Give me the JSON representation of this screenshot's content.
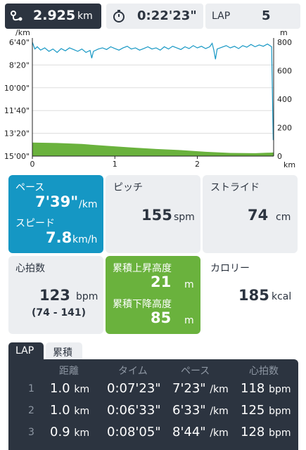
{
  "topbar": {
    "distance": {
      "icon": "route-icon",
      "value": "2.925",
      "unit": "km"
    },
    "time": {
      "icon": "stopwatch-icon",
      "value": "0:22'23\""
    },
    "lap": {
      "label": "LAP",
      "value": "5"
    }
  },
  "chart_data": {
    "type": "line",
    "x_label": "km",
    "x_ticks": [
      "0",
      "1",
      "2"
    ],
    "x_range": [
      0,
      2.925
    ],
    "left_axis": {
      "unit": "/km",
      "ticks": [
        "6'40\"",
        "8'20\"",
        "10'00\"",
        "11'40\"",
        "13'20\"",
        "15'00\""
      ],
      "range_sec": [
        400,
        900
      ],
      "inverted": true
    },
    "right_axis": {
      "unit": "m",
      "ticks": [
        "800",
        "600",
        "400",
        "200",
        "0"
      ],
      "range": [
        0,
        800
      ]
    },
    "series": [
      {
        "kind": "pace",
        "color": "#1597c4",
        "points": [
          [
            0,
            400
          ],
          [
            0.03,
            430
          ],
          [
            0.06,
            420
          ],
          [
            0.1,
            435
          ],
          [
            0.15,
            425
          ],
          [
            0.2,
            440
          ],
          [
            0.25,
            430
          ],
          [
            0.3,
            445
          ],
          [
            0.35,
            428
          ],
          [
            0.4,
            438
          ],
          [
            0.45,
            425
          ],
          [
            0.5,
            432
          ],
          [
            0.55,
            440
          ],
          [
            0.6,
            430
          ],
          [
            0.65,
            445
          ],
          [
            0.7,
            436
          ],
          [
            0.72,
            470
          ],
          [
            0.74,
            440
          ],
          [
            0.8,
            430
          ],
          [
            0.85,
            425
          ],
          [
            0.9,
            432
          ],
          [
            0.95,
            420
          ],
          [
            1.0,
            428
          ],
          [
            1.05,
            435
          ],
          [
            1.1,
            425
          ],
          [
            1.15,
            418
          ],
          [
            1.2,
            430
          ],
          [
            1.25,
            425
          ],
          [
            1.3,
            435
          ],
          [
            1.35,
            428
          ],
          [
            1.4,
            420
          ],
          [
            1.45,
            430
          ],
          [
            1.5,
            425
          ],
          [
            1.55,
            435
          ],
          [
            1.6,
            420
          ],
          [
            1.65,
            430
          ],
          [
            1.7,
            418
          ],
          [
            1.75,
            425
          ],
          [
            1.8,
            432
          ],
          [
            1.85,
            420
          ],
          [
            1.9,
            428
          ],
          [
            1.95,
            415
          ],
          [
            2.0,
            425
          ],
          [
            2.05,
            418
          ],
          [
            2.1,
            428
          ],
          [
            2.15,
            420
          ],
          [
            2.18,
            405
          ],
          [
            2.2,
            435
          ],
          [
            2.22,
            475
          ],
          [
            2.24,
            430
          ],
          [
            2.3,
            422
          ],
          [
            2.35,
            415
          ],
          [
            2.4,
            425
          ],
          [
            2.45,
            418
          ],
          [
            2.5,
            428
          ],
          [
            2.55,
            415
          ],
          [
            2.6,
            422
          ],
          [
            2.65,
            410
          ],
          [
            2.7,
            420
          ],
          [
            2.75,
            412
          ],
          [
            2.8,
            418
          ],
          [
            2.85,
            408
          ],
          [
            2.88,
            415
          ],
          [
            2.9,
            420
          ],
          [
            2.92,
            830
          ]
        ]
      },
      {
        "kind": "elevation",
        "color": "#6ab23d",
        "points": [
          [
            0,
            95
          ],
          [
            0.3,
            92
          ],
          [
            0.6,
            85
          ],
          [
            0.9,
            72
          ],
          [
            1.2,
            60
          ],
          [
            1.5,
            50
          ],
          [
            1.8,
            42
          ],
          [
            2.1,
            30
          ],
          [
            2.4,
            22
          ],
          [
            2.7,
            20
          ],
          [
            2.925,
            25
          ]
        ]
      }
    ]
  },
  "cards": {
    "pace": {
      "label": "ペース",
      "value": "7'39\"",
      "unit": "/km"
    },
    "speed": {
      "label": "スピード",
      "value": "7.8",
      "unit": "km/h"
    },
    "pitch": {
      "label": "ピッチ",
      "value": "155",
      "unit": "spm"
    },
    "stride": {
      "label": "ストライド",
      "value": "74",
      "unit": "cm"
    },
    "heart": {
      "label": "心拍数",
      "value": "123",
      "unit": "bpm",
      "range": "(74 - 141)"
    },
    "ascent": {
      "label": "累積上昇高度",
      "value": "21",
      "unit": "m"
    },
    "descent": {
      "label": "累積下降高度",
      "value": "85",
      "unit": "m"
    },
    "calorie": {
      "label": "カロリー",
      "value": "185",
      "unit": "kcal"
    }
  },
  "laps": {
    "tabs": [
      "LAP",
      "累積"
    ],
    "headers": [
      "距離",
      "タイム",
      "ペース",
      "心拍数"
    ],
    "rows": [
      {
        "n": "1",
        "dist": "1.0",
        "dist_unit": "km",
        "time": "0:07'23\"",
        "pace": "7'23\"",
        "pace_unit": "/km",
        "hr": "118",
        "hr_unit": "bpm"
      },
      {
        "n": "2",
        "dist": "1.0",
        "dist_unit": "km",
        "time": "0:06'33\"",
        "pace": "6'33\"",
        "pace_unit": "/km",
        "hr": "125",
        "hr_unit": "bpm"
      },
      {
        "n": "3",
        "dist": "0.9",
        "dist_unit": "km",
        "time": "0:08'05\"",
        "pace": "8'44\"",
        "pace_unit": "/km",
        "hr": "128",
        "hr_unit": "bpm"
      }
    ]
  }
}
